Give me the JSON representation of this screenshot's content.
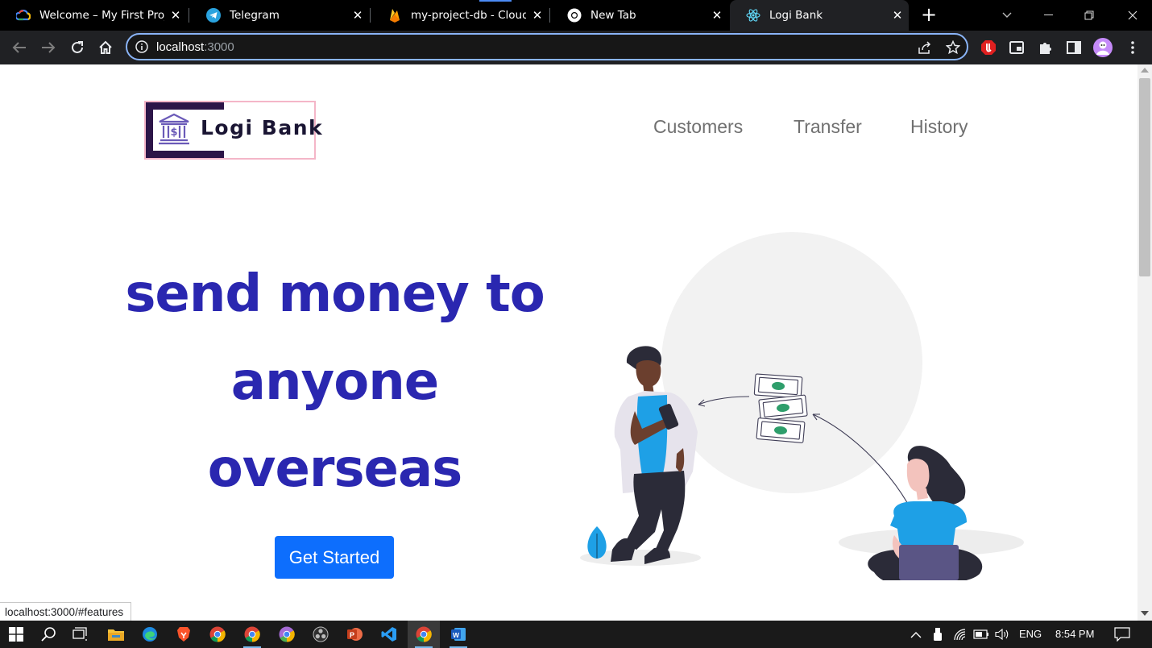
{
  "browser": {
    "tabs": [
      {
        "title": "Welcome – My First Proje",
        "favicon": "google-cloud-icon",
        "active": false
      },
      {
        "title": "Telegram",
        "favicon": "telegram-icon",
        "active": false
      },
      {
        "title": "my-project-db - Cloud Fir",
        "favicon": "firebase-icon",
        "active": false
      },
      {
        "title": "New Tab",
        "favicon": "chrome-icon",
        "active": false
      },
      {
        "title": "Logi Bank",
        "favicon": "react-icon",
        "active": true
      }
    ],
    "address": {
      "host": "localhost",
      "port": ":3000"
    },
    "status_url": "localhost:3000/#features"
  },
  "site": {
    "logo_text": "Logi Bank",
    "nav": [
      "Customers",
      "Transfer",
      "History"
    ],
    "hero": {
      "line1": "send money to",
      "line2": "anyone",
      "line3": "overseas",
      "cta": "Get Started"
    }
  },
  "taskbar": {
    "apps": [
      "start-icon",
      "search-icon",
      "task-view-icon",
      "file-explorer-icon",
      "edge-icon",
      "brave-icon",
      "chrome-icon",
      "chrome-icon",
      "chrome-canary-icon",
      "obs-icon",
      "powerpoint-icon",
      "vscode-icon",
      "chrome-icon",
      "word-icon"
    ],
    "language": "ENG",
    "time": "8:54 PM"
  },
  "colors": {
    "headline": "#2a27b0",
    "cta": "#0d6efd",
    "accent_illustration": "#1ea0e6",
    "omnibox_focus": "#8ab4f8"
  }
}
